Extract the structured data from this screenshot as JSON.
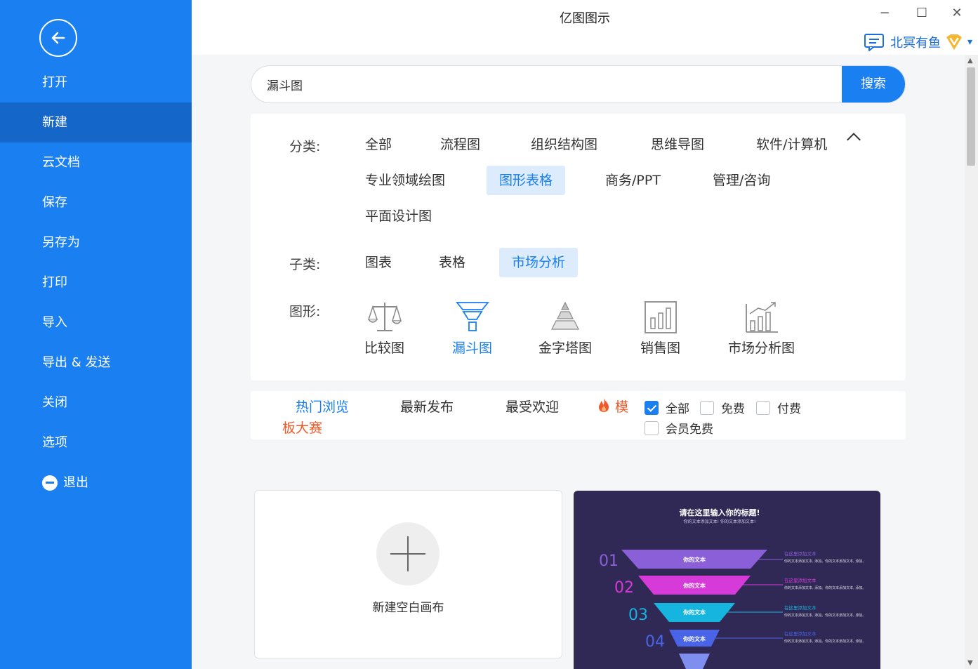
{
  "sidebar": {
    "items": [
      {
        "label": "打开"
      },
      {
        "label": "新建"
      },
      {
        "label": "云文档"
      },
      {
        "label": "保存"
      },
      {
        "label": "另存为"
      },
      {
        "label": "打印"
      },
      {
        "label": "导入"
      },
      {
        "label": "导出 & 发送"
      },
      {
        "label": "关闭"
      },
      {
        "label": "选项"
      }
    ],
    "exit_label": "退出",
    "active_item": "新建"
  },
  "window": {
    "title": "亿图图示",
    "minimize": "−",
    "maximize": "☐",
    "close": "✕"
  },
  "user": {
    "name": "北冥有鱼",
    "dropdown": "▾"
  },
  "search": {
    "value": "漏斗图",
    "button_label": "搜索"
  },
  "filters": {
    "category_label": "分类:",
    "categories": [
      {
        "label": "全部"
      },
      {
        "label": "流程图"
      },
      {
        "label": "组织结构图"
      },
      {
        "label": "思维导图"
      },
      {
        "label": "软件/计算机"
      },
      {
        "label": "专业领域绘图"
      },
      {
        "label": "图形表格",
        "selected": true
      },
      {
        "label": "商务/PPT"
      },
      {
        "label": "管理/咨询"
      },
      {
        "label": "平面设计图"
      }
    ],
    "subcategory_label": "子类:",
    "subcategories": [
      {
        "label": "图表"
      },
      {
        "label": "表格"
      },
      {
        "label": "市场分析",
        "selected": true
      }
    ],
    "shape_label": "图形:",
    "shapes": [
      {
        "label": "比较图",
        "icon": "balance-scale-icon"
      },
      {
        "label": "漏斗图",
        "icon": "funnel-icon",
        "selected": true
      },
      {
        "label": "金字塔图",
        "icon": "pyramid-icon"
      },
      {
        "label": "销售图",
        "icon": "bar-chart-icon"
      },
      {
        "label": "市场分析图",
        "icon": "growth-chart-icon"
      }
    ]
  },
  "sort": {
    "tabs": [
      {
        "label": "热门浏览",
        "active": true
      },
      {
        "label": "最新发布"
      },
      {
        "label": "最受欢迎"
      }
    ],
    "contest_part1": "模",
    "contest_part2": "板大赛",
    "checkboxes": [
      {
        "label": "全部",
        "checked": true
      },
      {
        "label": "免费",
        "checked": false
      },
      {
        "label": "付费",
        "checked": false
      },
      {
        "label": "会员免费",
        "checked": false
      }
    ]
  },
  "cards": {
    "new_canvas_label": "新建空白画布",
    "template": {
      "title": "请在这里输入你的标题!",
      "subtitle": "你的文本添加文本! 你的文本添加文本!",
      "levels": [
        {
          "num": "01",
          "text": "你的文本",
          "side_title": "在这里添加文本",
          "color": "#8b5fd8"
        },
        {
          "num": "02",
          "text": "你的文本",
          "side_title": "在这里添加文本",
          "color": "#d63ad8"
        },
        {
          "num": "03",
          "text": "你的文本",
          "side_title": "在这里添加文本",
          "color": "#15b5e0"
        },
        {
          "num": "04",
          "text": "你的文本",
          "side_title": "在这里添加文本",
          "color": "#4a64e8"
        }
      ],
      "side_body": "你的文本添加文本, 添加。你的文本添加文本, 添加。"
    }
  },
  "colors": {
    "sidebar": "#1a7ff0",
    "sidebar_active": "#1566c9",
    "accent": "#1a7ff0",
    "contest": "#ef5a2a",
    "template_bg": "#302956"
  }
}
